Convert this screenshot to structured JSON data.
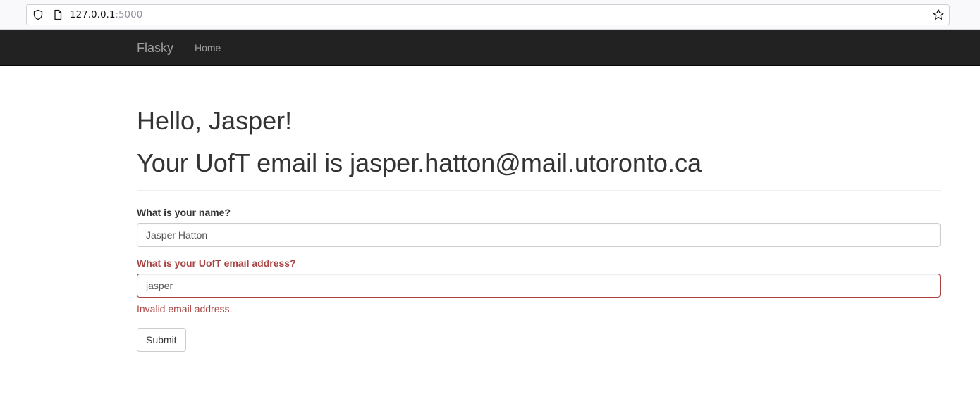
{
  "browser": {
    "url_host": "127.0.0.1",
    "url_port": ":5000",
    "icons": [
      "shield-icon",
      "page-icon",
      "star-icon"
    ]
  },
  "navbar": {
    "brand": "Flasky",
    "links": [
      {
        "label": "Home"
      }
    ]
  },
  "header": {
    "greeting": "Hello, Jasper!",
    "email_line": "Your UofT email is jasper.hatton@mail.utoronto.ca"
  },
  "form": {
    "name_label": "What is your name?",
    "name_value": "Jasper Hatton",
    "email_label": "What is your UofT email address?",
    "email_value": "jasper",
    "email_error": "Invalid email address.",
    "submit_label": "Submit"
  },
  "colors": {
    "navbar_bg": "#222222",
    "navbar_text": "#9d9d9d",
    "error": "#a94442"
  }
}
